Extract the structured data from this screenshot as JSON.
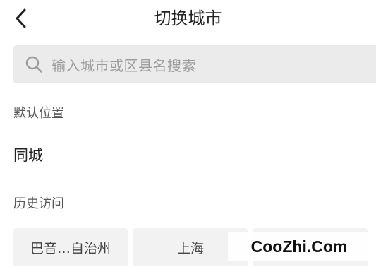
{
  "header": {
    "title": "切换城市",
    "back_icon": "chevron-left-icon"
  },
  "search": {
    "placeholder": "输入城市或区县名搜索",
    "icon": "search-icon"
  },
  "default_location": {
    "label": "默认位置",
    "value": "同城"
  },
  "history": {
    "label": "历史访问",
    "items": [
      {
        "label": "巴音…自治州"
      },
      {
        "label": "上海"
      },
      {
        "label": ""
      }
    ]
  },
  "watermark": {
    "text": "CooZhi.Com"
  },
  "colors": {
    "background": "#ffffff",
    "search_bg": "#ebebeb",
    "chip_bg": "#f2f2f2",
    "placeholder": "#9c9c9c"
  }
}
